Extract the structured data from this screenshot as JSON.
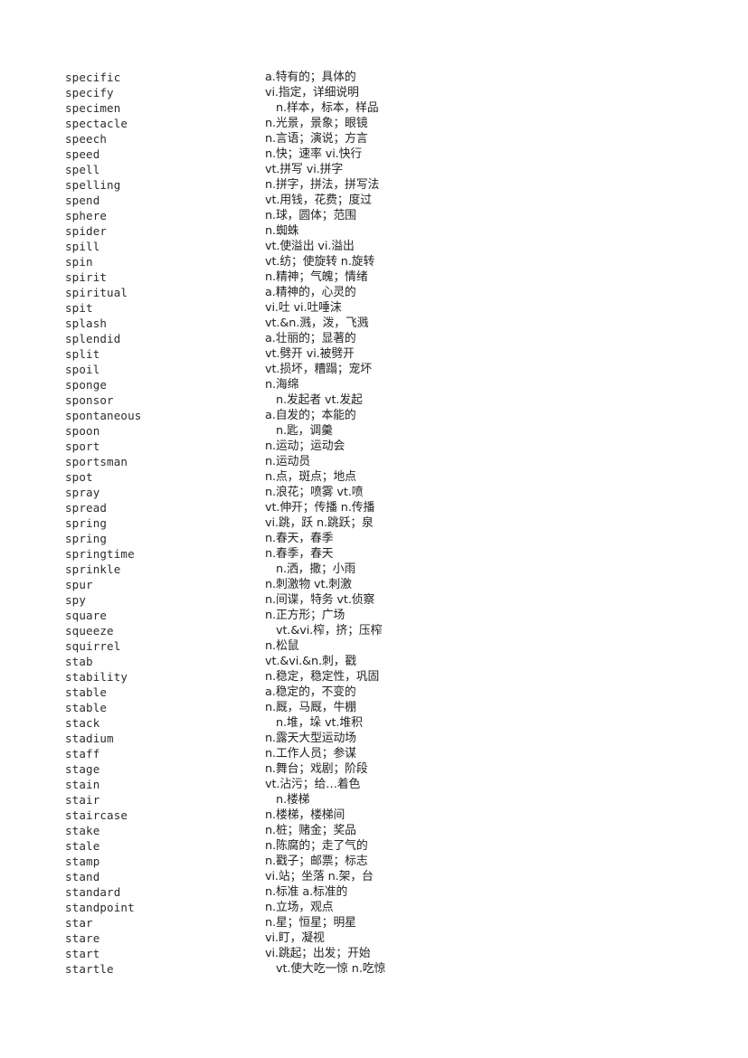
{
  "document": {
    "type": "vocabulary-word-list",
    "background_color": "#ffffff",
    "text_color": "#222222",
    "columns": [
      "word",
      "definition"
    ]
  },
  "entries": [
    {
      "word": "specific",
      "definition": "a.特有的；具体的",
      "indent": false
    },
    {
      "word": "specify",
      "definition": "vi.指定，详细说明",
      "indent": false
    },
    {
      "word": "specimen",
      "definition": "n.样本，标本，样品",
      "indent": true
    },
    {
      "word": "spectacle",
      "definition": "n.光景，景象；眼镜",
      "indent": false
    },
    {
      "word": "speech",
      "definition": "n.言语；演说；方言",
      "indent": false
    },
    {
      "word": "speed",
      "definition": "n.快；速率 vi.快行",
      "indent": false
    },
    {
      "word": "spell",
      "definition": "vt.拼写 vi.拼字",
      "indent": false
    },
    {
      "word": "spelling",
      "definition": "n.拼字，拼法，拼写法",
      "indent": false
    },
    {
      "word": "spend",
      "definition": "vt.用钱，花费；度过",
      "indent": false
    },
    {
      "word": "sphere",
      "definition": "n.球，圆体；范围",
      "indent": false
    },
    {
      "word": "spider",
      "definition": "n.蜘蛛",
      "indent": false
    },
    {
      "word": "spill",
      "definition": "vt.使溢出 vi.溢出",
      "indent": false
    },
    {
      "word": "spin",
      "definition": "vt.纺；使旋转 n.旋转",
      "indent": false
    },
    {
      "word": "spirit",
      "definition": "n.精神；气魄；情绪",
      "indent": false
    },
    {
      "word": "spiritual",
      "definition": "a.精神的，心灵的",
      "indent": false
    },
    {
      "word": "spit",
      "definition": "vi.吐 vi.吐唾沫",
      "indent": false
    },
    {
      "word": "splash",
      "definition": "vt.&n.溅，泼，飞溅",
      "indent": false
    },
    {
      "word": "splendid",
      "definition": "a.壮丽的；显著的",
      "indent": false
    },
    {
      "word": "split",
      "definition": "vt.劈开 vi.被劈开",
      "indent": false
    },
    {
      "word": "spoil",
      "definition": "vt.损坏，糟蹋；宠坏",
      "indent": false
    },
    {
      "word": "sponge",
      "definition": "n.海绵",
      "indent": false
    },
    {
      "word": "sponsor",
      "definition": "n.发起者 vt.发起",
      "indent": true
    },
    {
      "word": "spontaneous",
      "definition": "a.自发的；本能的",
      "indent": false
    },
    {
      "word": "spoon",
      "definition": "n.匙，调羹",
      "indent": true
    },
    {
      "word": "sport",
      "definition": "n.运动；运动会",
      "indent": false
    },
    {
      "word": "sportsman",
      "definition": "n.运动员",
      "indent": false
    },
    {
      "word": "spot",
      "definition": "n.点，斑点；地点",
      "indent": false
    },
    {
      "word": "spray",
      "definition": "n.浪花；喷雾 vt.喷",
      "indent": false
    },
    {
      "word": "spread",
      "definition": "vt.伸开；传播 n.传播",
      "indent": false
    },
    {
      "word": "spring",
      "definition": "vi.跳，跃 n.跳跃；泉",
      "indent": false
    },
    {
      "word": "spring",
      "definition": "n.春天，春季",
      "indent": false
    },
    {
      "word": "springtime",
      "definition": "n.春季，春天",
      "indent": false
    },
    {
      "word": "sprinkle",
      "definition": "n.洒，撒；小雨",
      "indent": true
    },
    {
      "word": "spur",
      "definition": "n.刺激物 vt.刺激",
      "indent": false
    },
    {
      "word": "spy",
      "definition": "n.间谍，特务 vt.侦察",
      "indent": false
    },
    {
      "word": "square",
      "definition": "n.正方形；广场",
      "indent": false
    },
    {
      "word": "squeeze",
      "definition": "vt.&vi.榨，挤；压榨",
      "indent": true
    },
    {
      "word": "squirrel",
      "definition": "n.松鼠",
      "indent": false
    },
    {
      "word": "stab",
      "definition": "vt.&vi.&n.刺，戳",
      "indent": false
    },
    {
      "word": "stability",
      "definition": "n.稳定，稳定性，巩固",
      "indent": false
    },
    {
      "word": "stable",
      "definition": "a.稳定的，不变的",
      "indent": false
    },
    {
      "word": "stable",
      "definition": "n.厩，马厩，牛棚",
      "indent": false
    },
    {
      "word": "stack",
      "definition": "n.堆，垛 vt.堆积",
      "indent": true
    },
    {
      "word": "stadium",
      "definition": "n.露天大型运动场",
      "indent": false
    },
    {
      "word": "staff",
      "definition": "n.工作人员；参谋",
      "indent": false
    },
    {
      "word": "stage",
      "definition": "n.舞台；戏剧；阶段",
      "indent": false
    },
    {
      "word": "stain",
      "definition": "vt.沾污；给…着色",
      "indent": false
    },
    {
      "word": "stair",
      "definition": "n.楼梯",
      "indent": true
    },
    {
      "word": "staircase",
      "definition": "n.楼梯，楼梯间",
      "indent": false
    },
    {
      "word": "stake",
      "definition": "n.桩；赌金；奖品",
      "indent": false
    },
    {
      "word": "stale",
      "definition": "n.陈腐的；走了气的",
      "indent": false
    },
    {
      "word": "stamp",
      "definition": "n.戳子；邮票；标志",
      "indent": false
    },
    {
      "word": "stand",
      "definition": "vi.站；坐落 n.架，台",
      "indent": false
    },
    {
      "word": "standard",
      "definition": "n.标准 a.标准的",
      "indent": false
    },
    {
      "word": "standpoint",
      "definition": "n.立场，观点",
      "indent": false
    },
    {
      "word": "star",
      "definition": "n.星；恒星；明星",
      "indent": false
    },
    {
      "word": "stare",
      "definition": "vi.盯，凝视",
      "indent": false
    },
    {
      "word": "start",
      "definition": "vi.跳起；出发；开始",
      "indent": false
    },
    {
      "word": "startle",
      "definition": "vt.使大吃一惊 n.吃惊",
      "indent": true
    }
  ]
}
